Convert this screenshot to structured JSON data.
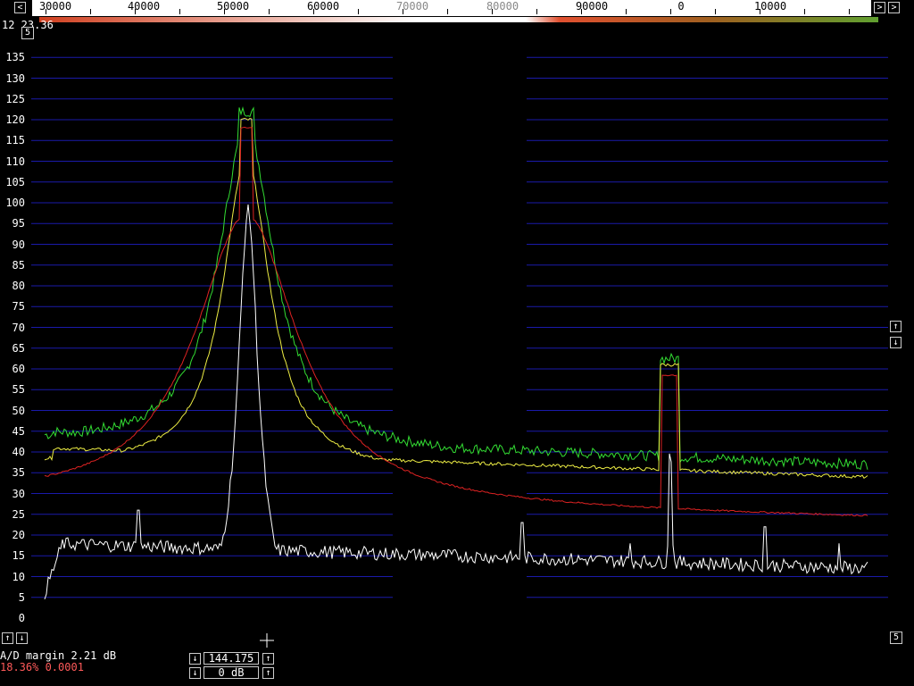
{
  "freq_axis": {
    "labels": [
      "30000",
      "40000",
      "50000",
      "60000",
      "70000",
      "80000",
      "90000",
      "0",
      "10000"
    ],
    "left_arrow": "<",
    "right_arrow": ">"
  },
  "top_left": {
    "gain_label": "12 23.36",
    "scale_button": "5"
  },
  "y_axis": {
    "labels": [
      "135",
      "130",
      "125",
      "120",
      "115",
      "110",
      "105",
      "100",
      "95",
      "90",
      "85",
      "80",
      "75",
      "70",
      "65",
      "60",
      "55",
      "50",
      "45",
      "40",
      "35",
      "30",
      "25",
      "20",
      "15",
      "10",
      "5",
      "0"
    ]
  },
  "right_controls": {
    "up_arrow": "↑",
    "down_arrow": "↓",
    "scale_button": "5"
  },
  "bottom_left": {
    "up_arrow": "↑",
    "down_arrow": "↓"
  },
  "status": {
    "ad_margin": "A/D margin  2.21 dB",
    "percentage": "18.36% 0.0001"
  },
  "freq_control": {
    "frequency": "144.175",
    "level": "0 dB",
    "up": "↑",
    "down": "↓"
  },
  "colors": {
    "grid": "#1a1aaa",
    "green": "#33dd33",
    "yellow": "#eeee44",
    "red": "#dd2222",
    "white": "#ffffff"
  }
}
